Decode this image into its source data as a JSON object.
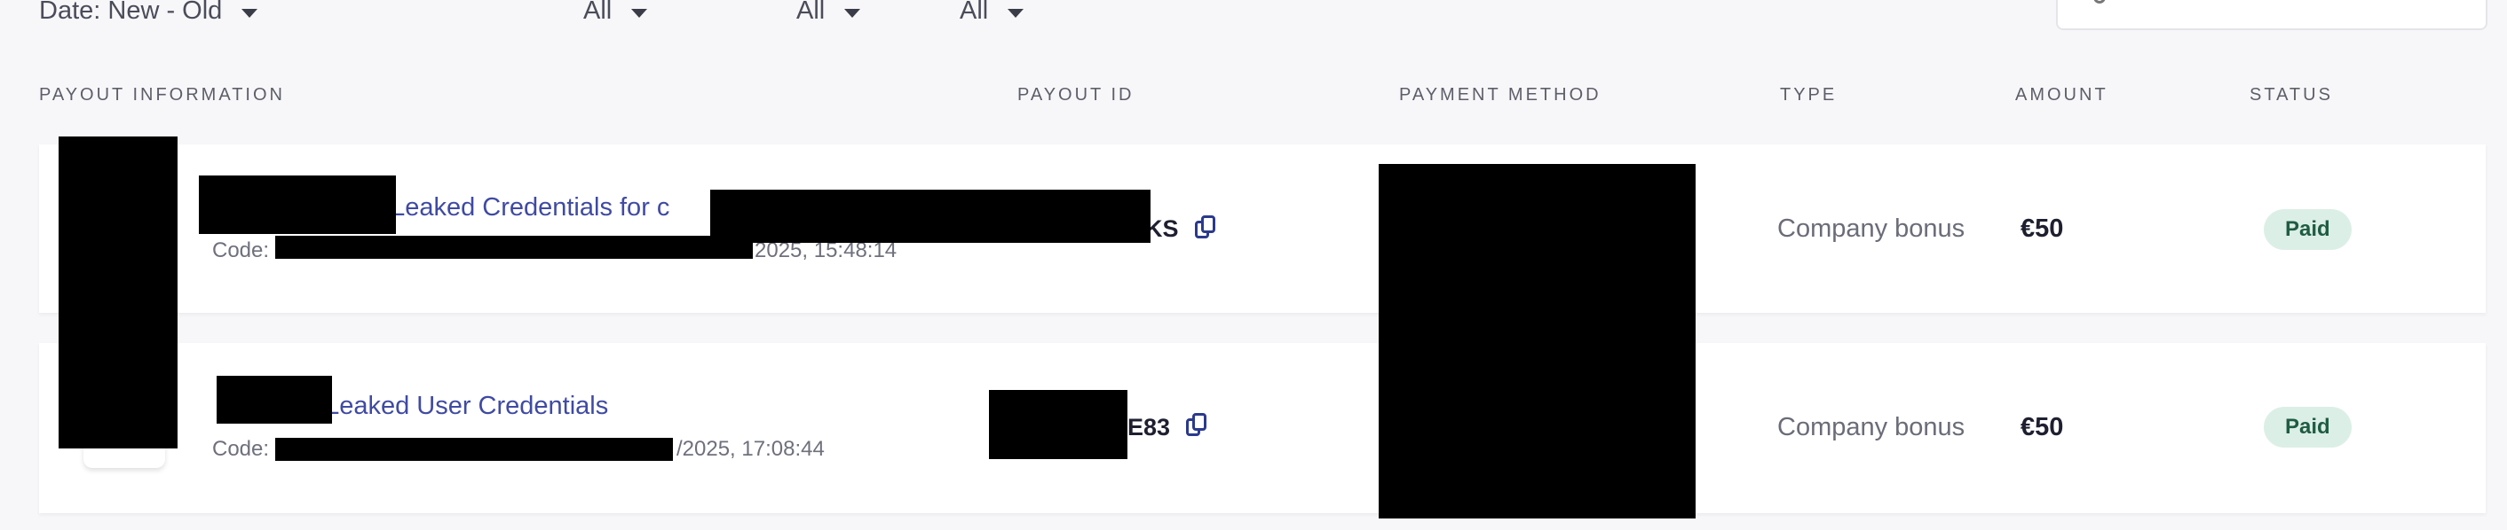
{
  "filters": {
    "date_sort": "Date: New - Old",
    "filter2": "All",
    "filter3": "All",
    "filter4": "All"
  },
  "table": {
    "headers": [
      "PAYOUT INFORMATION",
      "PAYOUT ID",
      "PAYMENT METHOD",
      "TYPE",
      "AMOUNT",
      "STATUS"
    ],
    "rows": [
      {
        "title": "Leaked Credentials for c",
        "separator": "/",
        "code_label": "Code:",
        "datetime": "2025, 15:48:14",
        "payout_id_suffix": "KS",
        "type": "Company bonus",
        "amount": "€50",
        "status": "Paid"
      },
      {
        "title": "Leaked User Credentials",
        "separator": "/",
        "code_label": "Code:",
        "datetime": "/2025, 17:08:44",
        "payout_id_suffix": "E83",
        "type": "Company bonus",
        "amount": "€50",
        "status": "Paid"
      }
    ]
  },
  "colors": {
    "background": "#f7f7f9",
    "link": "#3f4aa3",
    "status_bg": "#dcefe6",
    "status_text": "#1f5c43"
  }
}
